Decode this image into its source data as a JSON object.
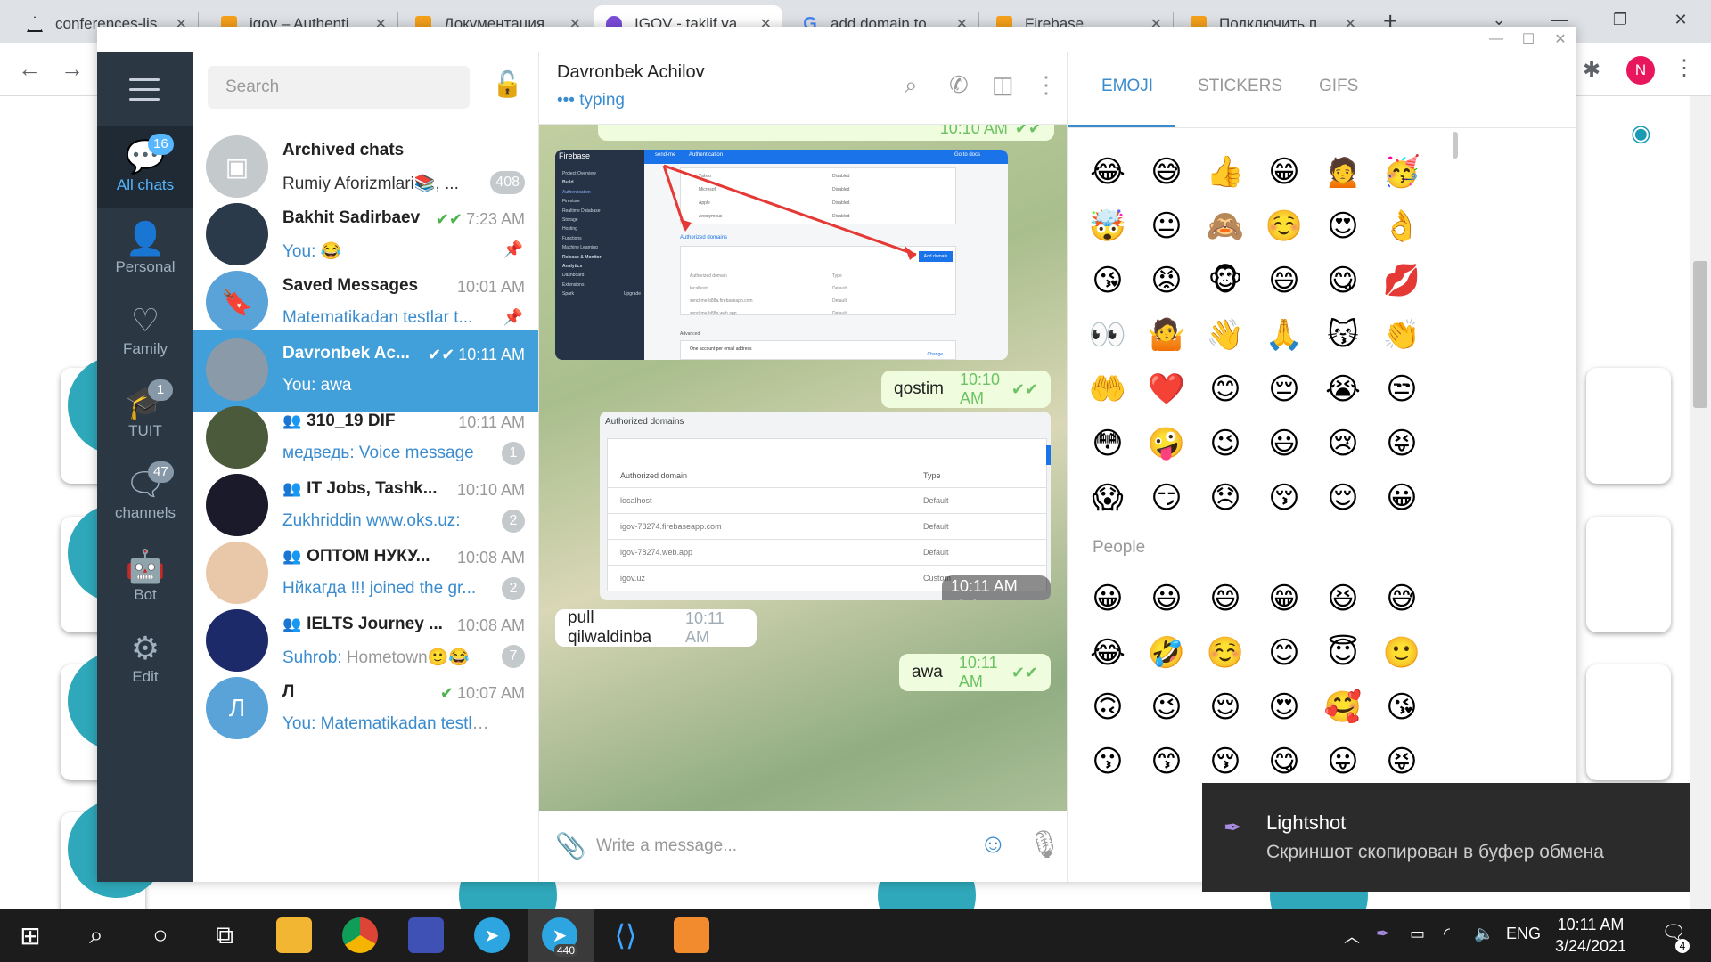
{
  "browser": {
    "tabs": [
      {
        "label": "conferences-lis",
        "fav": "#1b1f23"
      },
      {
        "label": "igov – Authenti",
        "fav": "#f6a11a"
      },
      {
        "label": "Документация",
        "fav": "#f6a11a"
      },
      {
        "label": "IGOV - taklif va",
        "fav": "#7b4ddb"
      },
      {
        "label": "add domain to",
        "fav": "#4285f4"
      },
      {
        "label": "Firebase",
        "fav": "#f6a11a"
      },
      {
        "label": "Подключить п",
        "fav": "#f6a11a"
      }
    ],
    "new_tab": "+",
    "profile_initial": "N"
  },
  "telegram": {
    "folders": [
      {
        "label": "All chats",
        "badge": "16",
        "icon": "chat-bubbles-icon"
      },
      {
        "label": "Personal",
        "badge": "",
        "icon": "person-icon"
      },
      {
        "label": "Family",
        "badge": "",
        "icon": "heart-icon"
      },
      {
        "label": "TUIT",
        "badge": "1",
        "icon": "graduation-cap-icon"
      },
      {
        "label": "channels",
        "badge": "47",
        "icon": "chat-icon"
      },
      {
        "label": "Bot",
        "badge": "",
        "icon": "bot-icon"
      },
      {
        "label": "Edit",
        "badge": "",
        "icon": "sliders-icon"
      }
    ],
    "search_placeholder": "Search",
    "chats": [
      {
        "name": "Archived chats",
        "time": "",
        "preview": "Rumiy Aforizmlari📚, ...",
        "count": "408",
        "color": "#c4c9cc",
        "initial": "▣"
      },
      {
        "name": "Bakhit Sadirbaev",
        "time": "7:23 AM",
        "sender": "You:",
        "preview": " 😂",
        "count": "",
        "color": "#2a3a4a",
        "initial": ""
      },
      {
        "name": "Saved Messages",
        "time": "10:01 AM",
        "preview": "Matematikadan testlar t...",
        "count": "",
        "color": "#5aa3d8",
        "initial": "🔖"
      },
      {
        "name": "Davronbek Ac...",
        "time": "10:11 AM",
        "sender": "You:",
        "preview": " awa",
        "count": "",
        "color": "#8a9aa8",
        "initial": ""
      },
      {
        "name": "310_19 DIF",
        "time": "10:11 AM",
        "sender": "медведь:",
        "preview": " Voice message",
        "count": "1",
        "color": "#4a5a3a",
        "initial": ""
      },
      {
        "name": "IT Jobs, Tashk...",
        "time": "10:10 AM",
        "sender": "Zukhriddin",
        "preview": " www.oks.uz:",
        "count": "2",
        "color": "#1a1a2a",
        "initial": ""
      },
      {
        "name": "ОПТОМ НУКУ...",
        "time": "10:08 AM",
        "sender": "Нйкагда !!!",
        "preview": " joined the gr...",
        "count": "2",
        "color": "#e8c8a8",
        "initial": ""
      },
      {
        "name": "IELTS Journey ...",
        "time": "10:08 AM",
        "sender": "Suhrob:",
        "preview": " Hometown🙂😂",
        "count": "7",
        "color": "#1c2a6a",
        "initial": ""
      },
      {
        "name": "Л",
        "time": "10:07 AM",
        "sender": "You:",
        "preview": " Matematikadan testlar ...",
        "count": "",
        "color": "#5aa3d8",
        "initial": "Л"
      }
    ],
    "conversation": {
      "name": "Davronbek Achilov",
      "status": "typing",
      "top_time": "10:10 AM",
      "msg1": {
        "text": "qostim",
        "time": "10:10 AM"
      },
      "shot2_time": "10:11 AM",
      "msg2": {
        "text": "pull qilwaldinba",
        "time": "10:11 AM"
      },
      "msg3": {
        "text": "awa",
        "time": "10:11 AM"
      },
      "input_placeholder": "Write a message...",
      "shot1": {
        "brand": "Firebase",
        "project": "send-me",
        "section": "Authentication",
        "go_docs": "Go to docs",
        "nav": [
          "Project Overview",
          "Build",
          "Authentication",
          "Firestore",
          "Realtime Database",
          "Storage",
          "Hosting",
          "Functions",
          "Machine Learning",
          "Release & Monitor",
          "Analytics",
          "Dashboard",
          "Extensions",
          "Spark",
          "Upgrade"
        ],
        "providers": [
          {
            "name": "Yahoo",
            "state": "Disabled"
          },
          {
            "name": "Microsoft",
            "state": "Disabled"
          },
          {
            "name": "Apple",
            "state": "Disabled"
          },
          {
            "name": "Anonymous",
            "state": "Disabled"
          }
        ],
        "auth_title": "Authorized domains",
        "add_domain": "Add domain",
        "headers": [
          "Authorized domain",
          "Type"
        ],
        "domains": [
          {
            "d": "localhost",
            "t": "Default"
          },
          {
            "d": "send-me-b88a.firebaseapp.com",
            "t": "Default"
          },
          {
            "d": "send-me-b88a.web.app",
            "t": "Default"
          }
        ],
        "advanced": "Advanced",
        "one_account": "One account per email address",
        "change": "Change"
      },
      "shot2": {
        "title": "Authorized domains",
        "headers": [
          "Authorized domain",
          "Type"
        ],
        "rows": [
          {
            "d": "localhost",
            "t": "Default"
          },
          {
            "d": "igov-78274.firebaseapp.com",
            "t": "Default"
          },
          {
            "d": "igov-78274.web.app",
            "t": "Default"
          },
          {
            "d": "igov.uz",
            "t": "Custom"
          }
        ]
      }
    },
    "emoji_panel": {
      "tabs": [
        "EMOJI",
        "STICKERS",
        "GIFS"
      ],
      "recent": [
        [
          "😂",
          "😅",
          "👍",
          "😁",
          "🙍",
          "🥳"
        ],
        [
          "🤯",
          "😐",
          "🙈",
          "☺️",
          "😍",
          "👌"
        ],
        [
          "😘",
          "😡",
          "🐵",
          "😄",
          "😋",
          "💋"
        ],
        [
          "👀",
          "🤷",
          "👋",
          "🙏",
          "😽",
          "👏"
        ],
        [
          "🤲",
          "❤️",
          "😊",
          "😔",
          "😭",
          "😒"
        ],
        [
          "😳",
          "🤪",
          "😉",
          "😃",
          "😢",
          "😝"
        ],
        [
          "😱",
          "😏",
          "😞",
          "😚",
          "😌",
          "😀"
        ]
      ],
      "section": "People",
      "people": [
        [
          "😀",
          "😃",
          "😄",
          "😁",
          "😆",
          "😅"
        ],
        [
          "😂",
          "🤣",
          "☺️",
          "😊",
          "😇",
          "🙂"
        ],
        [
          "🙃",
          "😉",
          "😌",
          "😍",
          "🥰",
          "😘"
        ],
        [
          "😗",
          "😙",
          "😚",
          "😋",
          "😛",
          "😝"
        ]
      ]
    }
  },
  "toast": {
    "title": "Lightshot",
    "text": "Скриншот скопирован в буфер обмена"
  },
  "taskbar": {
    "time": "10:11 AM",
    "date": "3/24/2021",
    "lang": "ENG",
    "telegram_badge": "440",
    "notif": "4"
  }
}
